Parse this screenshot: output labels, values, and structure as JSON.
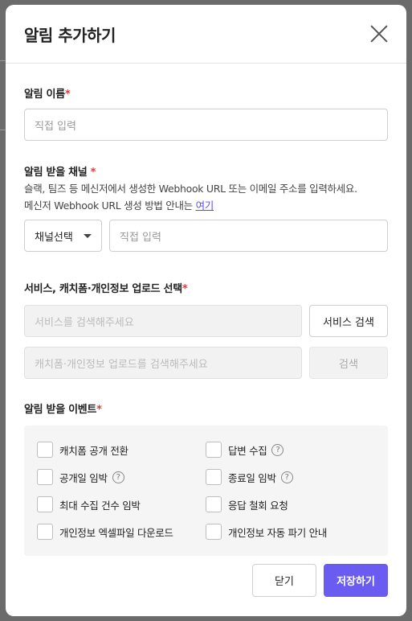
{
  "modal": {
    "title": "알림 추가하기"
  },
  "name_field": {
    "label": "알림 이름",
    "required": "*",
    "placeholder": "직접 입력"
  },
  "channel_field": {
    "label": "알림 받을 채널",
    "required": "*",
    "description_line1": "슬랙, 팀즈 등 메신저에서 생성한 Webhook URL 또는 이메일 주소를 입력하세요.",
    "description_line2": "메신저 Webhook URL 생성 방법 안내는",
    "help_link": "여기",
    "select_value": "채널선택",
    "input_placeholder": "직접 입력"
  },
  "service_field": {
    "label": "서비스, 캐치폼·개인정보 업로드 선택",
    "required": "*",
    "service_placeholder": "서비스를 검색해주세요",
    "service_search_button": "서비스 검색",
    "upload_placeholder": "캐치폼·개인정보 업로드를 검색해주세요",
    "upload_search_button": "검색"
  },
  "events_field": {
    "label": "알림 받을 이벤트",
    "required": "*",
    "items": [
      {
        "label": "캐치폼 공개 전환",
        "help": false
      },
      {
        "label": "답변 수집",
        "help": true
      },
      {
        "label": "공개일 임박",
        "help": true
      },
      {
        "label": "종료일 임박",
        "help": true
      },
      {
        "label": "최대 수집 건수 임박",
        "help": false
      },
      {
        "label": "응답 철회 요청",
        "help": false
      },
      {
        "label": "개인정보 엑셀파일 다운로드",
        "help": false
      },
      {
        "label": "개인정보 자동 파기 안내",
        "help": false
      }
    ],
    "help_glyph": "?"
  },
  "footer": {
    "cancel_label": "닫기",
    "save_label": "저장하기"
  },
  "colors": {
    "accent": "#6a5cf0",
    "required": "#e23a3a",
    "overlay": "#6b6b6b"
  }
}
